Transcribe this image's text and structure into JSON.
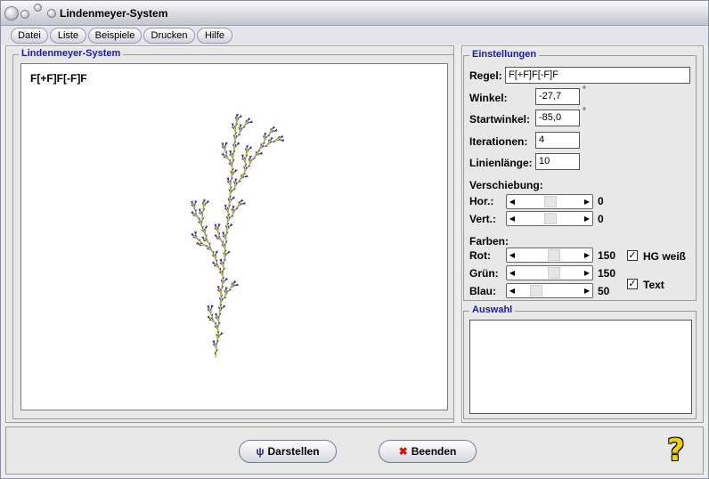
{
  "window": {
    "title": "Lindenmeyer-System"
  },
  "menu": {
    "items": [
      {
        "label": "Datei"
      },
      {
        "label": "Liste"
      },
      {
        "label": "Beispiele"
      },
      {
        "label": "Drucken"
      },
      {
        "label": "Hilfe"
      }
    ]
  },
  "canvas_panel": {
    "legend": "Lindenmeyer-System",
    "rule_display": "F[+F]F[-F]F",
    "colors": {
      "branch": "#a0a040",
      "leaf": "#2a2a78"
    }
  },
  "settings": {
    "legend": "Einstellungen",
    "regel_label": "Regel:",
    "regel_value": "F[+F]F[-F]F",
    "winkel_label": "Winkel:",
    "winkel_value": "-27,7",
    "startwinkel_label": "Startwinkel:",
    "startwinkel_value": "-85,0",
    "degree_mark": "°",
    "iterationen_label": "Iterationen:",
    "iterationen_value": "4",
    "linienlaenge_label": "Linienlänge:",
    "linienlaenge_value": "10",
    "verschiebung_label": "Verschiebung:",
    "hor_label": "Hor.:",
    "hor_value": "0",
    "vert_label": "Vert.:",
    "vert_value": "0",
    "farben_label": "Farben:",
    "rot_label": "Rot:",
    "rot_value": "150",
    "gruen_label": "Grün:",
    "gruen_value": "150",
    "blau_label": "Blau:",
    "blau_value": "50",
    "hg_weiss_label": "HG weiß",
    "hg_weiss_checked": true,
    "text_label": "Text",
    "text_checked": true
  },
  "auswahl": {
    "legend": "Auswahl"
  },
  "buttons": {
    "darstellen": "Darstellen",
    "beenden": "Beenden"
  },
  "icons": {
    "check": "✓",
    "left_arrow": "◀",
    "right_arrow": "▶",
    "help": "?",
    "close": "✖",
    "plant": "ψ"
  }
}
